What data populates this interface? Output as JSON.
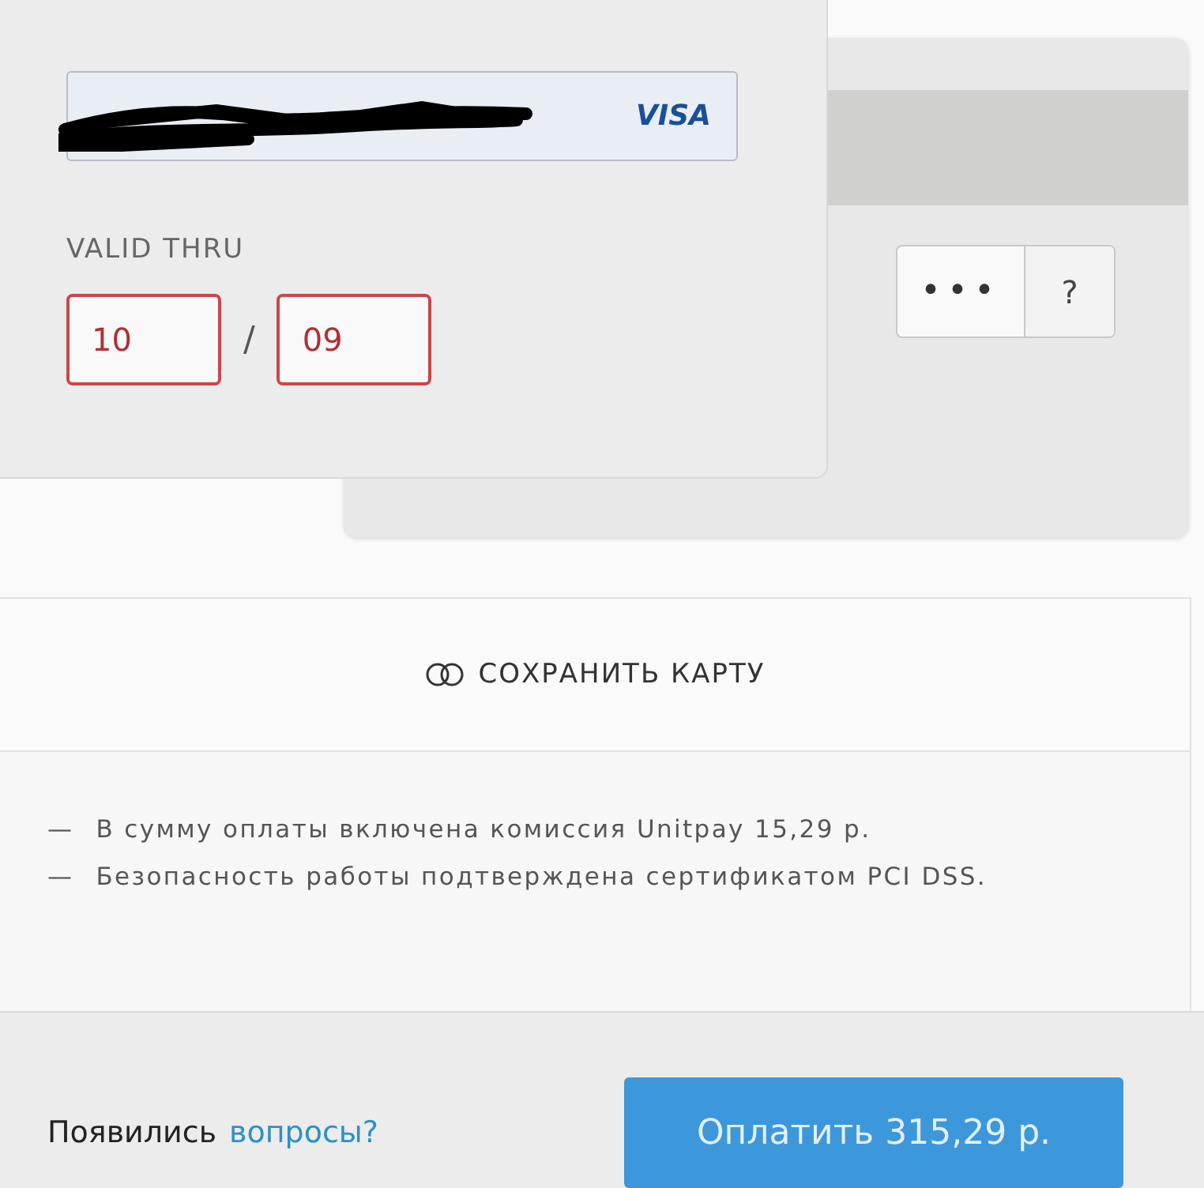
{
  "card_front": {
    "brand": "VISA",
    "valid_thru_label": "VALID THRU",
    "expiry": [
      {
        "value": "10",
        "invalid": true
      },
      {
        "value": "09",
        "invalid": true
      }
    ],
    "separator": "/"
  },
  "card_back": {
    "cvv_mask": "•••",
    "help": "?"
  },
  "save_card": {
    "label": "СОХРАНИТЬ КАРТУ",
    "checked": false
  },
  "notes": [
    {
      "dash": "—",
      "text": "В сумму оплаты включена комиссия Unitpay 15,29 р."
    },
    {
      "dash": "—",
      "text": "Безопасность работы подтверждена сертификатом PCI DSS."
    }
  ],
  "footer": {
    "question": "Появились",
    "link": "вопросы?",
    "pay_button": "Оплатить 315,29 р."
  }
}
